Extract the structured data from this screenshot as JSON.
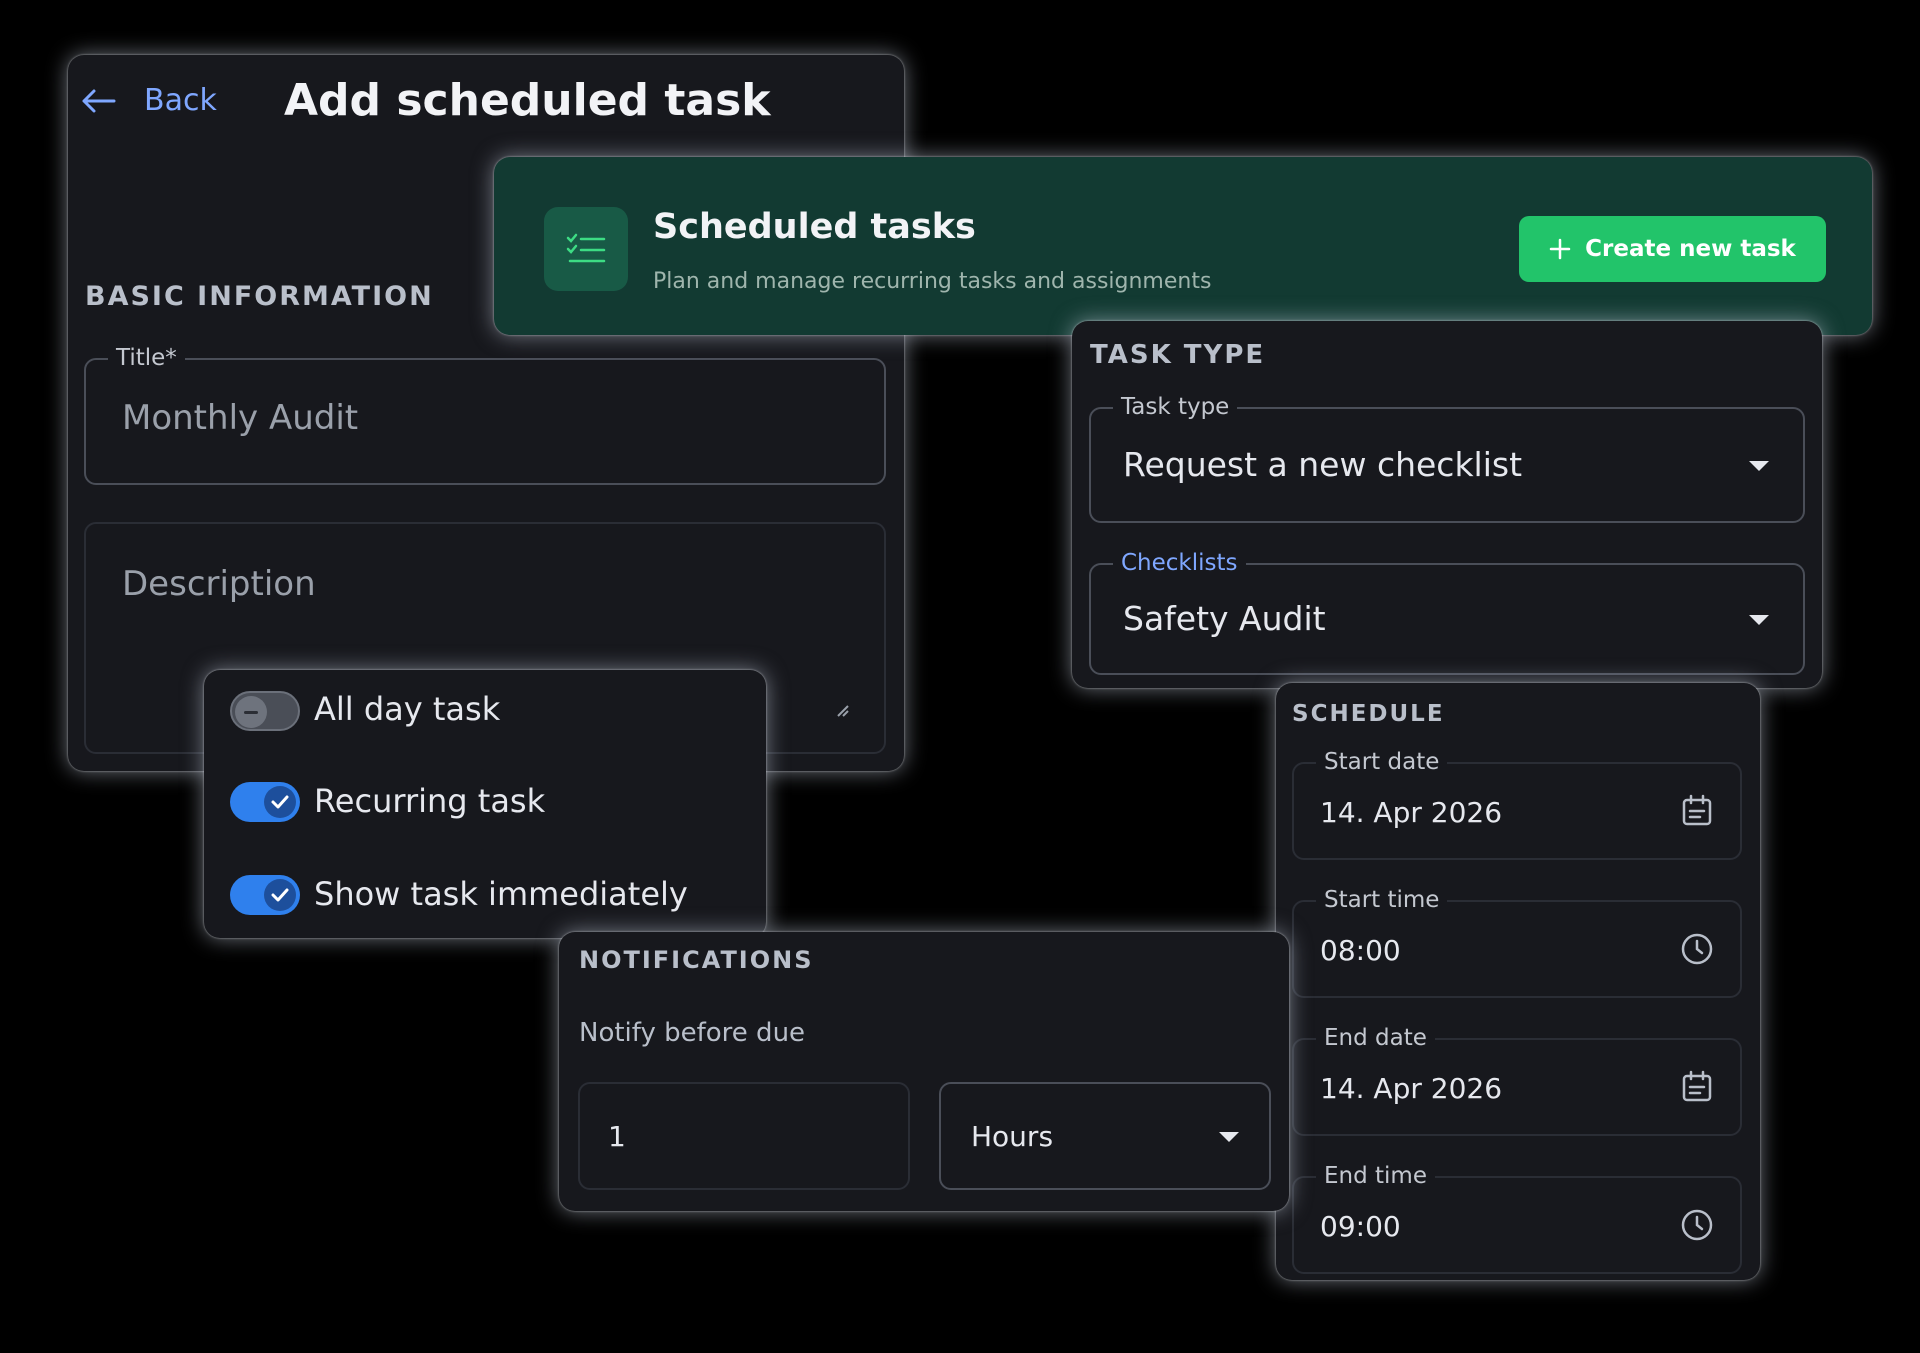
{
  "form": {
    "back_label": "Back",
    "page_title": "Add scheduled task",
    "basic_info_heading": "BASIC INFORMATION",
    "title_label": "Title*",
    "title_value": "Monthly Audit",
    "description_placeholder": "Description"
  },
  "toggles": [
    {
      "label": "All day task",
      "on": false
    },
    {
      "label": "Recurring task",
      "on": true
    },
    {
      "label": "Show task immediately",
      "on": true
    }
  ],
  "header_card": {
    "title": "Scheduled tasks",
    "subtitle": "Plan and manage recurring tasks and assignments",
    "create_button_label": "Create new task",
    "icon": "checklist-icon",
    "accent": "#22c46a"
  },
  "task_type": {
    "heading": "TASK TYPE",
    "type_label": "Task type",
    "type_value": "Request a new checklist",
    "checklists_label": "Checklists",
    "checklists_value": "Safety Audit"
  },
  "schedule": {
    "heading": "SCHEDULE",
    "start_date_label": "Start date",
    "start_date_value": "14. Apr 2026",
    "start_time_label": "Start time",
    "start_time_value": "08:00",
    "end_date_label": "End date",
    "end_date_value": "14. Apr 2026",
    "end_time_label": "End time",
    "end_time_value": "09:00"
  },
  "notifications": {
    "heading": "NOTIFICATIONS",
    "notify_label": "Notify before due",
    "amount_value": "1",
    "unit_value": "Hours"
  },
  "colors": {
    "toggle_on": "#2f80ed",
    "link": "#7fa7ff"
  }
}
